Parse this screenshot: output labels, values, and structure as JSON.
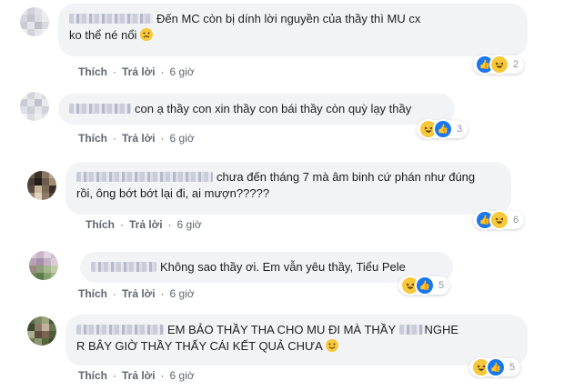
{
  "actions": {
    "like": "Thích",
    "reply": "Trả lời",
    "sep": "·"
  },
  "comments": [
    {
      "text_line1": "Đến MC còn bị dính lời nguyền của thầy thì MU cx",
      "text_line2": "ko thể né nổi",
      "inline_emoji": "sad-face-emoji",
      "time": "6 giờ",
      "reaction_count": "2",
      "reactions": [
        "like",
        "haha"
      ]
    },
    {
      "text_line1": "con ạ thầy con xin thầy con bái thầy còn quỳ lạy thầy",
      "time": "6 giờ",
      "reaction_count": "3",
      "reactions": [
        "haha",
        "like"
      ]
    },
    {
      "text_line1": "chưa đến tháng 7 mà âm binh cứ phán như đúng",
      "text_line2": "rồi, ông bớt bớt lại đi, ai mượn?????",
      "time": "6 giờ",
      "reaction_count": "6",
      "reactions": [
        "like",
        "haha"
      ]
    },
    {
      "text_line1": "Không sao thầy ơi. Em vẫn yêu thầy, Tiểu Pele",
      "time": "6 giờ",
      "reaction_count": "5",
      "reactions": [
        "haha",
        "like"
      ]
    },
    {
      "text_line1": "EM BẢO THẦY THA CHO MU ĐI MÀ THẦY",
      "text_line1b": "NGHE",
      "text_line2": "R BÂY GIỜ THẦY THẤY CÁI KẾT QUẢ CHƯA",
      "inline_emoji": "smile-emoji",
      "time": "6 giờ",
      "reaction_count": "5",
      "reactions": [
        "haha",
        "like"
      ]
    }
  ],
  "colors": {
    "bubble": "#f2f3f5",
    "like_blue": "#1877f2",
    "haha_yellow": "#f7c83b",
    "meta_gray": "#606770"
  }
}
